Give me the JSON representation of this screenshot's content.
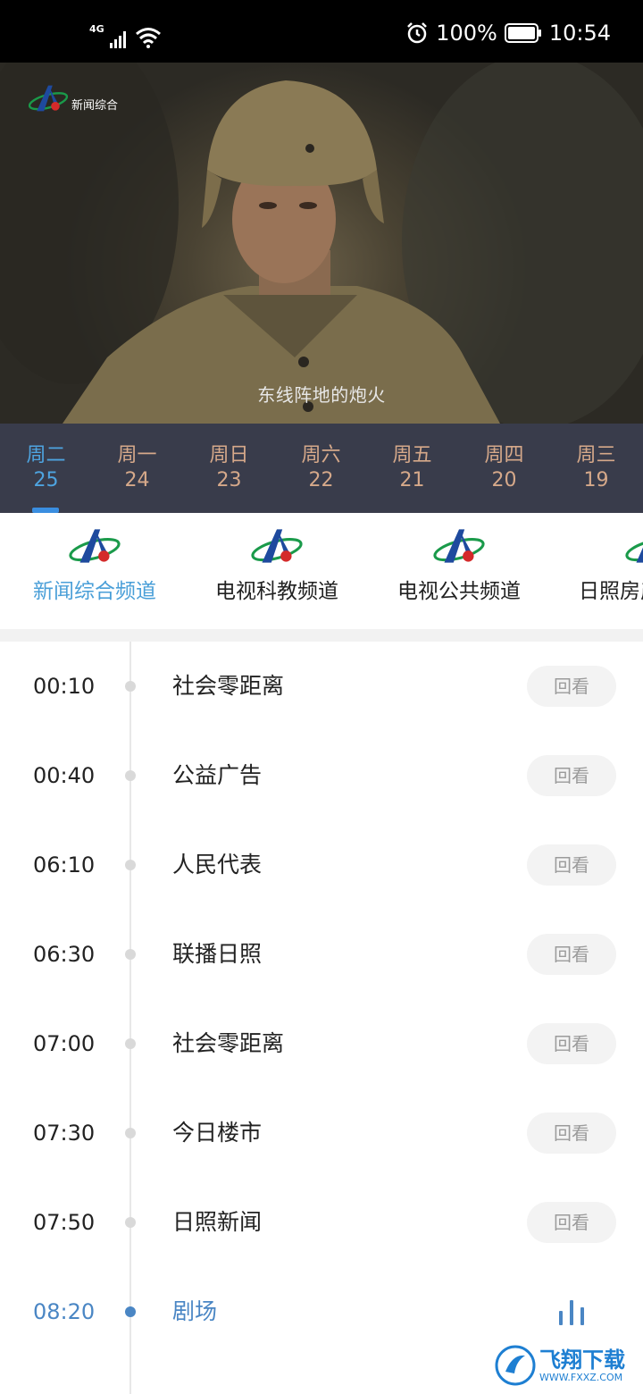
{
  "status_bar": {
    "network": "4G",
    "battery": "100%",
    "time": "10:54",
    "icons": [
      "signal-icon",
      "wifi-icon",
      "alarm-icon",
      "battery-icon"
    ]
  },
  "player": {
    "logo_text": "新闻综合",
    "subtitle": "东线阵地的炮火"
  },
  "dates": [
    {
      "weekday": "周二",
      "day": "25",
      "active": true
    },
    {
      "weekday": "周一",
      "day": "24"
    },
    {
      "weekday": "周日",
      "day": "23"
    },
    {
      "weekday": "周六",
      "day": "22"
    },
    {
      "weekday": "周五",
      "day": "21"
    },
    {
      "weekday": "周四",
      "day": "20"
    },
    {
      "weekday": "周三",
      "day": "19"
    }
  ],
  "channels": [
    {
      "name": "新闻综合频道",
      "active": true
    },
    {
      "name": "电视科教频道"
    },
    {
      "name": "电视公共频道"
    },
    {
      "name": "日照房产频道"
    }
  ],
  "programs": [
    {
      "time": "00:10",
      "title": "社会零距离",
      "action": "回看"
    },
    {
      "time": "00:40",
      "title": "公益广告",
      "action": "回看"
    },
    {
      "time": "06:10",
      "title": "人民代表",
      "action": "回看"
    },
    {
      "time": "06:30",
      "title": "联播日照",
      "action": "回看"
    },
    {
      "time": "07:00",
      "title": "社会零距离",
      "action": "回看"
    },
    {
      "time": "07:30",
      "title": "今日楼市",
      "action": "回看"
    },
    {
      "time": "07:50",
      "title": "日照新闻",
      "action": "回看"
    },
    {
      "time": "08:20",
      "title": "剧场",
      "live": true
    }
  ],
  "watermark": {
    "text": "飞翔下载",
    "sub": "WWW.FXXZ.COM"
  },
  "colors": {
    "accent_blue": "#4a9fd8",
    "date_bar_bg": "#393c4b",
    "date_inactive": "#d6a98a",
    "live_blue": "#4a86c4"
  }
}
